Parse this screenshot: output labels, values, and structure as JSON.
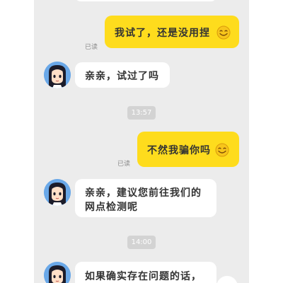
{
  "conversation": {
    "messages": [
      {
        "sender": "user",
        "text": "我试了，还是没用捏",
        "emoji": "smile-emoji",
        "status": "已读"
      },
      {
        "sender": "agent",
        "text": "亲亲，试过了吗"
      },
      {
        "type": "time",
        "text": "13:57"
      },
      {
        "sender": "user",
        "text": "不然我骗你吗",
        "emoji": "smile-emoji",
        "status": "已读"
      },
      {
        "sender": "agent",
        "lines": [
          "亲亲，建议您前往我们的",
          "网点检测呢"
        ]
      },
      {
        "type": "time",
        "text": "14:00"
      },
      {
        "sender": "agent",
        "text": "如果确实存在问题的话，"
      }
    ]
  },
  "colors": {
    "background": "#ececec",
    "user_bubble": "#fedc1d",
    "agent_bubble": "#ffffff",
    "time_pill": "#d3d3d3"
  },
  "icons": {
    "avatar": "cartoon-girl-avatar",
    "emoji": "smile-emoji"
  }
}
